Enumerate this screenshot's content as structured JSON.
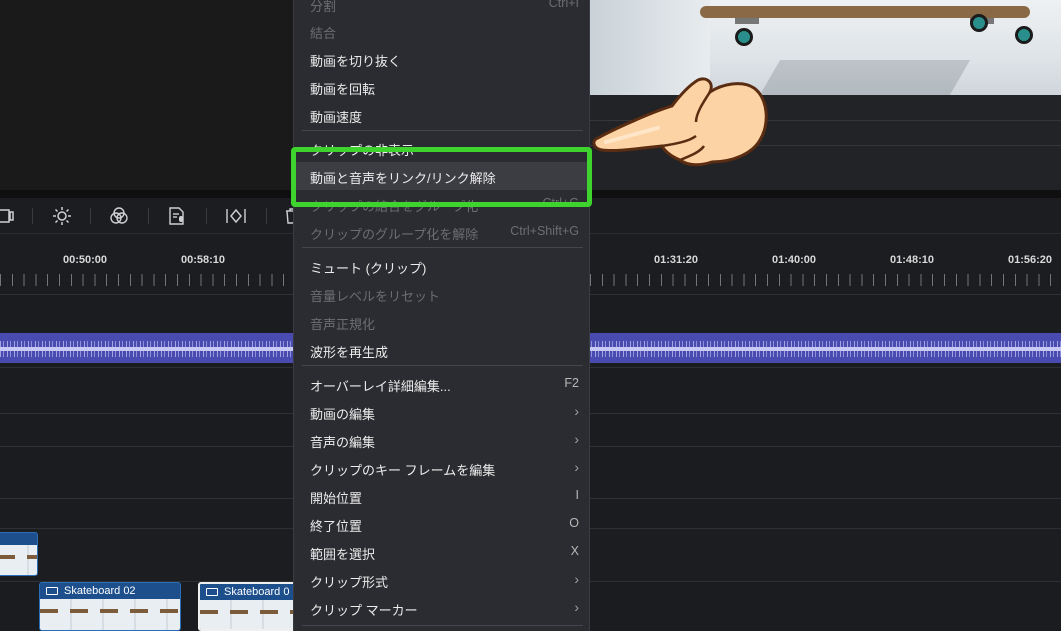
{
  "menu": {
    "items": [
      {
        "label": "分割",
        "shortcut": "Ctrl+I",
        "disabled": true,
        "submenu": false
      },
      {
        "label": "結合",
        "shortcut": "",
        "disabled": true,
        "submenu": false
      },
      {
        "label": "動画を切り抜く",
        "shortcut": "",
        "disabled": false,
        "submenu": false
      },
      {
        "label": "動画を回転",
        "shortcut": "",
        "disabled": false,
        "submenu": false
      },
      {
        "label": "動画速度",
        "shortcut": "",
        "disabled": false,
        "submenu": false
      },
      {
        "label": "クリップの非表示",
        "shortcut": "",
        "disabled": false,
        "submenu": false
      },
      {
        "label": "動画と音声をリンク/リンク解除",
        "shortcut": "",
        "disabled": false,
        "submenu": false
      },
      {
        "label": "クリップの結合をグループ化",
        "shortcut": "Ctrl+G",
        "disabled": true,
        "submenu": false
      },
      {
        "label": "クリップのグループ化を解除",
        "shortcut": "Ctrl+Shift+G",
        "disabled": true,
        "submenu": false
      },
      {
        "label": "ミュート (クリップ)",
        "shortcut": "",
        "disabled": false,
        "submenu": false
      },
      {
        "label": "音量レベルをリセット",
        "shortcut": "",
        "disabled": true,
        "submenu": false
      },
      {
        "label": "音声正規化",
        "shortcut": "",
        "disabled": true,
        "submenu": false
      },
      {
        "label": "波形を再生成",
        "shortcut": "",
        "disabled": false,
        "submenu": false
      },
      {
        "label": "オーバーレイ詳細編集...",
        "shortcut": "F2",
        "disabled": false,
        "submenu": false
      },
      {
        "label": "動画の編集",
        "shortcut": "",
        "disabled": false,
        "submenu": true
      },
      {
        "label": "音声の編集",
        "shortcut": "",
        "disabled": false,
        "submenu": true
      },
      {
        "label": "クリップのキー フレームを編集",
        "shortcut": "",
        "disabled": false,
        "submenu": true
      },
      {
        "label": "開始位置",
        "shortcut": "I",
        "disabled": false,
        "submenu": false
      },
      {
        "label": "終了位置",
        "shortcut": "O",
        "disabled": false,
        "submenu": false
      },
      {
        "label": "範囲を選択",
        "shortcut": "X",
        "disabled": false,
        "submenu": false
      },
      {
        "label": "クリップ形式",
        "shortcut": "",
        "disabled": false,
        "submenu": true
      },
      {
        "label": "クリップ マーカー",
        "shortcut": "",
        "disabled": false,
        "submenu": true
      }
    ],
    "highlighted_label": "動画と音声をリンク/リンク解除",
    "arrow_glyph": "›"
  },
  "ruler": {
    "labels": [
      "00:50:00",
      "00:58:10",
      "01:31:20",
      "01:40:00",
      "01:48:10",
      "01:56:20"
    ]
  },
  "clips": [
    {
      "title": "",
      "icon": "video-icon"
    },
    {
      "title": "Skateboard 02",
      "icon": "video-icon"
    },
    {
      "title": "Skateboard 0",
      "icon": "video-icon"
    }
  ],
  "toolbar": {
    "icons": [
      "crop-icon",
      "brightness-icon",
      "color-icon",
      "voiceover-icon",
      "split-view-icon",
      "delete-icon"
    ]
  },
  "colors": {
    "highlight_box": "#3fd42d",
    "clip_blue": "#1c4f8c",
    "audio_wave": "#4a4bb0"
  }
}
